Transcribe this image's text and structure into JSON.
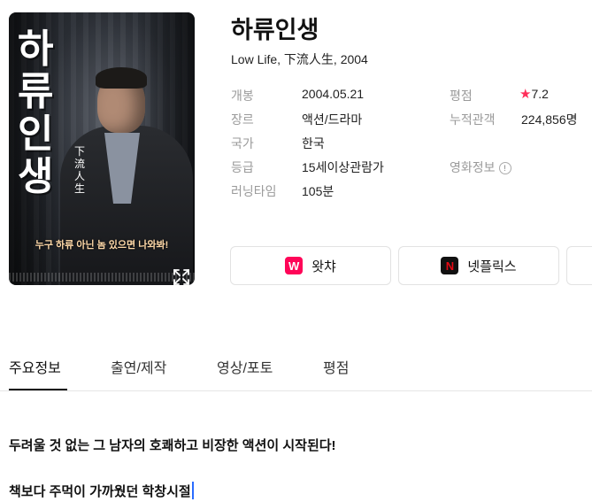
{
  "poster": {
    "title_text": "하류인생",
    "hanja_text": "下流人生",
    "tagline": "누구 하류 아닌 놈 있으면 나와봐!"
  },
  "movie": {
    "title": "하류인생",
    "subtitle": "Low Life, 下流人生, 2004"
  },
  "details": {
    "release_label": "개봉",
    "release_value": "2004.05.21",
    "genre_label": "장르",
    "genre_value": "액션/드라마",
    "country_label": "국가",
    "country_value": "한국",
    "rating_label": "등급",
    "rating_value": "15세이상관람가",
    "runtime_label": "러닝타임",
    "runtime_value": "105분",
    "score_label": "평점",
    "score_value": "7.2",
    "audience_label": "누적관객",
    "audience_value": "224,856명",
    "movieinfo_label": "영화정보"
  },
  "ott": [
    {
      "label": "왓챠",
      "logo_char": "W",
      "color": "#ff0558"
    },
    {
      "label": "넷플릭스",
      "logo_char": "N",
      "color": "#e50914"
    }
  ],
  "tabs": [
    {
      "label": "주요정보"
    },
    {
      "label": "출연/제작"
    },
    {
      "label": "영상/포토"
    },
    {
      "label": "평점"
    }
  ],
  "description": {
    "line1": "두려울 것 없는 그 남자의 호쾌하고 비장한 액션이 시작된다!",
    "line2": "책보다 주먹이 가까웠던 학창시절"
  },
  "colors": {
    "star": "#ff2f5a",
    "caret": "#2a6cff",
    "label_gray": "#9a9a9a"
  }
}
